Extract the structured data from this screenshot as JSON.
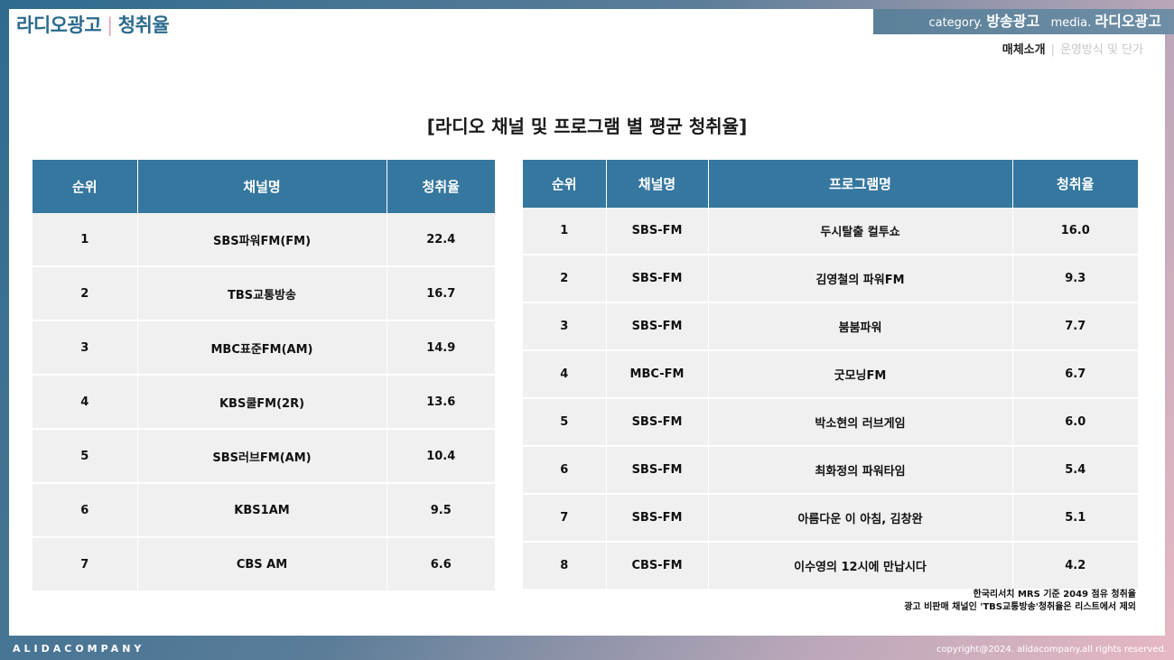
{
  "header": {
    "section": "라디오광고",
    "separator": "|",
    "topic": "청취율",
    "category_label": "category.",
    "category_value": "방송광고",
    "media_label": "media.",
    "media_value": "라디오광고",
    "subnav_active": "매체소개",
    "subnav_divider": "|",
    "subnav_inactive": "운영방식 및 단가"
  },
  "heading": "[라디오 채널 및 프로그램 별 평균 청취율]",
  "left_table": {
    "columns": [
      "순위",
      "채널명",
      "청취율"
    ],
    "rows": [
      [
        "1",
        "SBS파워FM(FM)",
        "22.4"
      ],
      [
        "2",
        "TBS교통방송",
        "16.7"
      ],
      [
        "3",
        "MBC표준FM(AM)",
        "14.9"
      ],
      [
        "4",
        "KBS쿨FM(2R)",
        "13.6"
      ],
      [
        "5",
        "SBS러브FM(AM)",
        "10.4"
      ],
      [
        "6",
        "KBS1AM",
        "9.5"
      ],
      [
        "7",
        "CBS AM",
        "6.6"
      ]
    ]
  },
  "right_table": {
    "columns": [
      "순위",
      "채널명",
      "프로그램명",
      "청취율"
    ],
    "rows": [
      [
        "1",
        "SBS-FM",
        "두시탈출 컬투쇼",
        "16.0"
      ],
      [
        "2",
        "SBS-FM",
        "김영철의 파워FM",
        "9.3"
      ],
      [
        "3",
        "SBS-FM",
        "붐붐파워",
        "7.7"
      ],
      [
        "4",
        "MBC-FM",
        "굿모닝FM",
        "6.7"
      ],
      [
        "5",
        "SBS-FM",
        "박소현의 러브게임",
        "6.0"
      ],
      [
        "6",
        "SBS-FM",
        "최화정의 파워타임",
        "5.4"
      ],
      [
        "7",
        "SBS-FM",
        "아름다운 이 아침, 김창완",
        "5.1"
      ],
      [
        "8",
        "CBS-FM",
        "이수영의 12시에 만납시다",
        "4.2"
      ]
    ]
  },
  "notes": [
    "한국리서치 MRS 기준 2049 점유 청취율",
    "광고 비판매 채널인 'TBS교통방송'청취율은 리스트에서 제외"
  ],
  "footer": {
    "brand": "ALIDACOMPANY",
    "copyright": "copyright@2024. alidacompany.all rights reserved."
  }
}
